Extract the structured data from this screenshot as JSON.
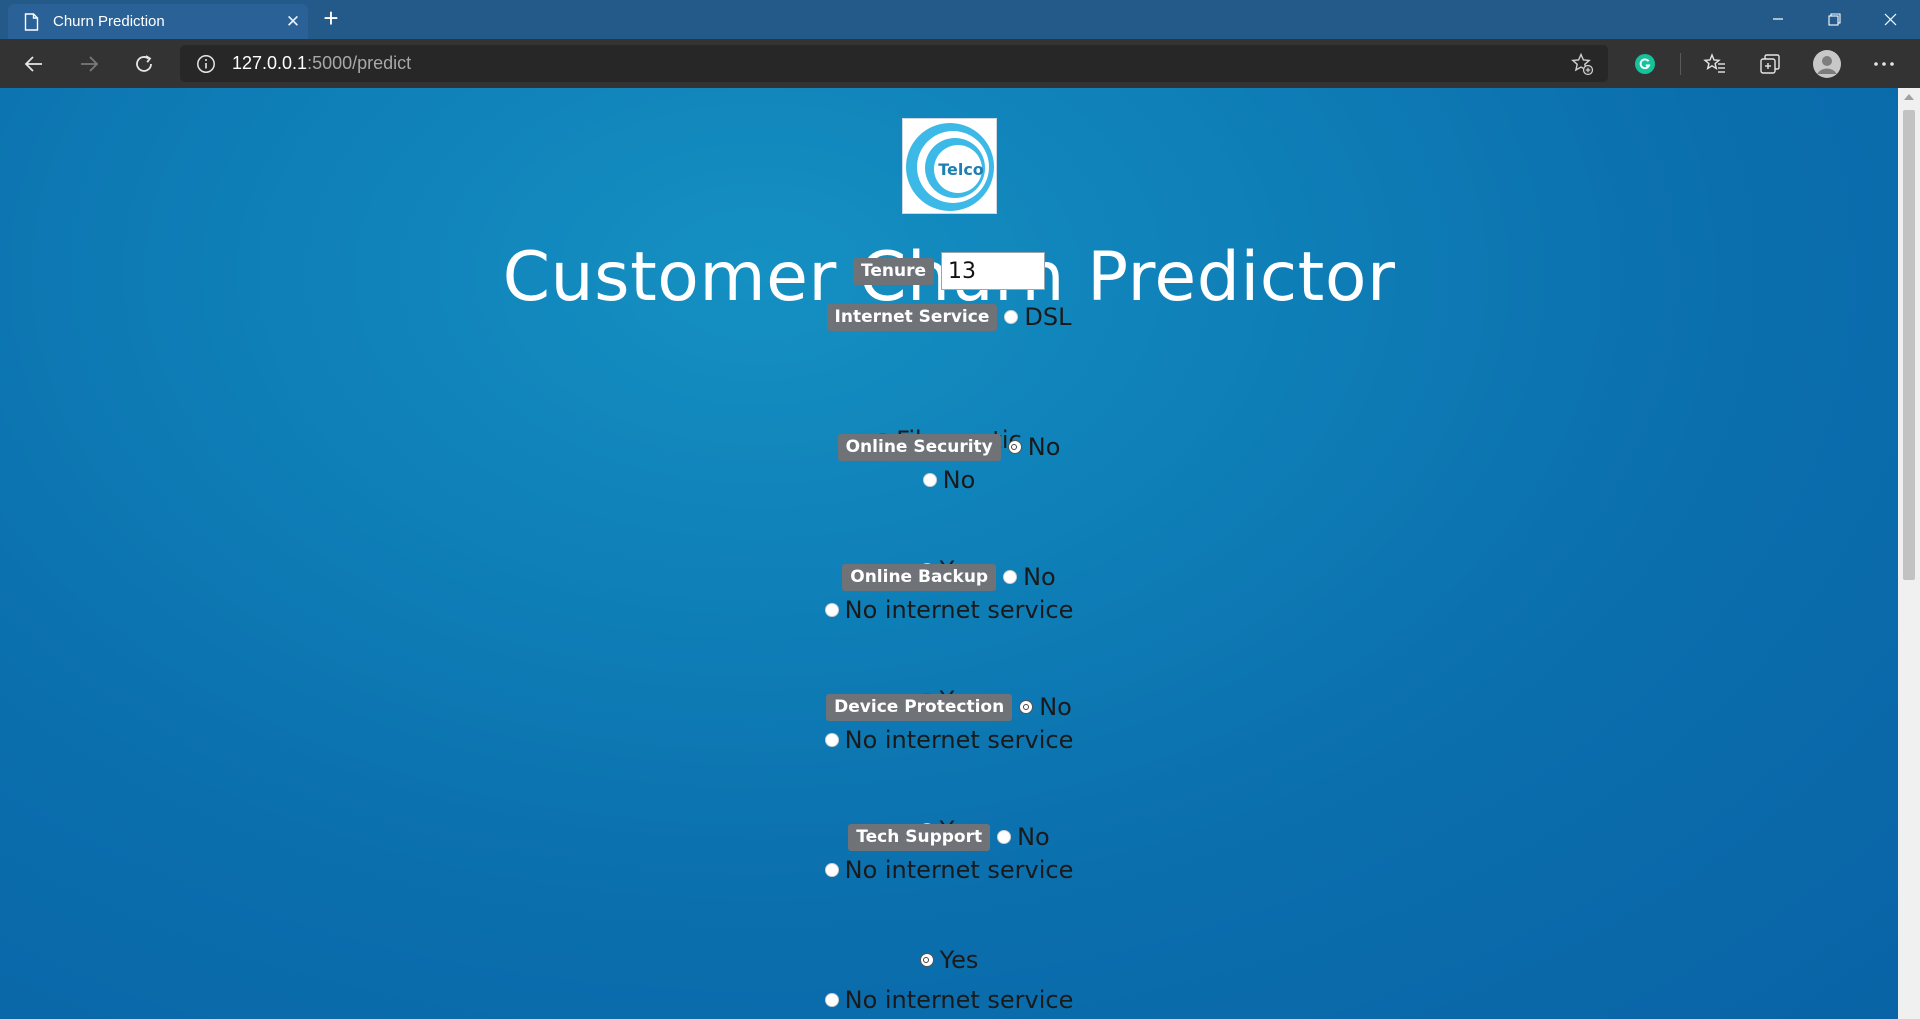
{
  "browser": {
    "tab_title": "Churn Prediction",
    "tab_close": "✕",
    "new_tab": "+",
    "url_host": "127.0.0.1",
    "url_rest": ":5000/predict"
  },
  "page": {
    "logo_text": "Telco",
    "title": "Customer Churn Predictor",
    "tenure": {
      "label": "Tenure",
      "value": "13"
    },
    "groups": [
      {
        "label": "Internet Service",
        "options": [
          "DSL",
          "Fiber optic",
          "No"
        ],
        "selected": 1
      },
      {
        "label": "Online Security",
        "options": [
          "No",
          "Yes",
          "No internet service"
        ],
        "selected": 0
      },
      {
        "label": "Online Backup",
        "options": [
          "No",
          "Yes",
          "No internet service"
        ],
        "selected": 1
      },
      {
        "label": "Device Protection",
        "options": [
          "No",
          "Yes",
          "No internet service"
        ],
        "selected": 0
      },
      {
        "label": "Tech Support",
        "options": [
          "No",
          "Yes",
          "No internet service"
        ],
        "selected": 1
      }
    ]
  },
  "colors": {
    "titlebar": "#245a8a",
    "toolbar": "#333333",
    "page_gradient_start": "#1590c2",
    "page_gradient_end": "#0963a6",
    "label_badge": "#6f7378",
    "grammarly": "#15c39a"
  },
  "icons": [
    "page-icon",
    "close-icon",
    "plus-icon",
    "minimize-icon",
    "restore-icon",
    "window-close-icon",
    "back-arrow-icon",
    "forward-arrow-icon",
    "refresh-icon",
    "info-icon",
    "star-plus-icon",
    "grammarly-icon",
    "favorites-icon",
    "collections-icon",
    "profile-icon",
    "more-icon"
  ]
}
